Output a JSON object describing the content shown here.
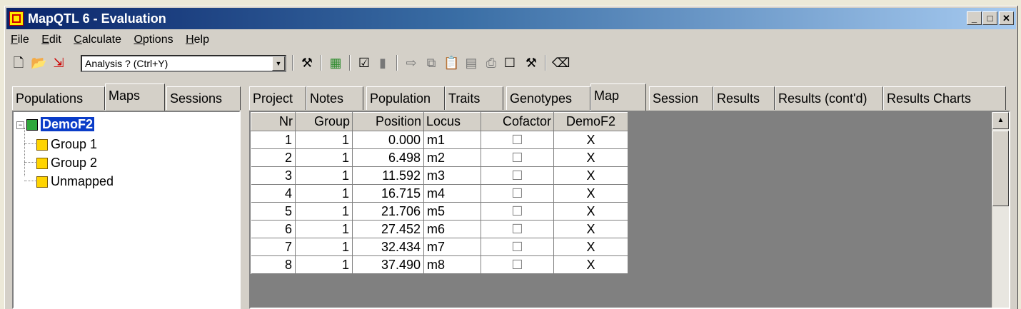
{
  "window": {
    "title": "MapQTL 6 - Evaluation",
    "controls": {
      "minimize": "_",
      "maximize": "□",
      "close": "✕"
    }
  },
  "menu": {
    "items": [
      {
        "u": "F",
        "rest": "ile"
      },
      {
        "u": "E",
        "rest": "dit"
      },
      {
        "u": "C",
        "rest": "alculate"
      },
      {
        "u": "O",
        "rest": "ptions"
      },
      {
        "u": "H",
        "rest": "elp"
      }
    ]
  },
  "toolbar": {
    "combo_value": "Analysis ? (Ctrl+Y)",
    "icons": [
      "new-icon",
      "open-icon",
      "import-icon",
      "dropdown-arrow-icon",
      "hammer-icon",
      "grid-icon",
      "checkbox-icon",
      "square-icon",
      "export-icon",
      "copy-icon",
      "paste-icon",
      "calculator-icon",
      "print-icon",
      "checkbox-empty-icon",
      "tools-icon",
      "eraser-icon"
    ]
  },
  "left_tabs": [
    {
      "label": "Populations",
      "active": false
    },
    {
      "label": "Maps",
      "active": true
    },
    {
      "label": "Sessions",
      "active": false
    }
  ],
  "right_tabs": [
    {
      "label": "Project",
      "active": false
    },
    {
      "label": "Notes",
      "active": false
    },
    {
      "label": "Population",
      "active": false
    },
    {
      "label": "Traits",
      "active": false
    },
    {
      "label": "Genotypes",
      "active": false
    },
    {
      "label": "Map",
      "active": true
    },
    {
      "label": "Session",
      "active": false
    },
    {
      "label": "Results",
      "active": false
    },
    {
      "label": "Results (cont'd)",
      "active": false
    },
    {
      "label": "Results Charts",
      "active": false
    }
  ],
  "tree": {
    "root": "DemoF2",
    "children": [
      "Group 1",
      "Group 2",
      "Unmapped"
    ]
  },
  "table": {
    "columns": [
      "Nr",
      "Group",
      "Position",
      "Locus",
      "Cofactor",
      "DemoF2"
    ],
    "rows": [
      [
        "1",
        "1",
        "0.000",
        "m1",
        "☐",
        "X"
      ],
      [
        "2",
        "1",
        "6.498",
        "m2",
        "☐",
        "X"
      ],
      [
        "3",
        "1",
        "11.592",
        "m3",
        "☐",
        "X"
      ],
      [
        "4",
        "1",
        "16.715",
        "m4",
        "☐",
        "X"
      ],
      [
        "5",
        "1",
        "21.706",
        "m5",
        "☐",
        "X"
      ],
      [
        "6",
        "1",
        "27.452",
        "m6",
        "☐",
        "X"
      ],
      [
        "7",
        "1",
        "32.434",
        "m7",
        "☐",
        "X"
      ],
      [
        "8",
        "1",
        "37.490",
        "m8",
        "☐",
        "X"
      ]
    ]
  }
}
